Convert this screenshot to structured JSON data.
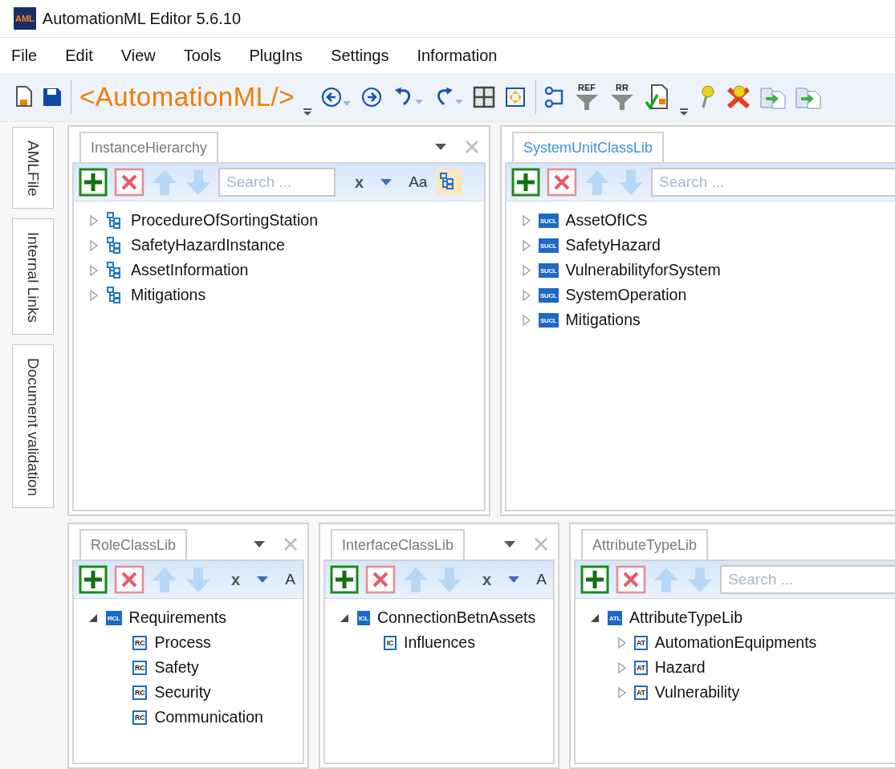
{
  "window": {
    "app_icon_label": "AML",
    "title": "AutomationML Editor 5.6.10"
  },
  "menu": [
    "File",
    "Edit",
    "View",
    "Tools",
    "PlugIns",
    "Settings",
    "Information"
  ],
  "toolbar": [
    {
      "kind": "new-file"
    },
    {
      "kind": "save"
    },
    {
      "kind": "separator"
    },
    {
      "kind": "logo",
      "label": "<AutomationML/>"
    },
    {
      "kind": "overflow"
    },
    {
      "kind": "back",
      "dropdown": true
    },
    {
      "kind": "forward",
      "dropdown": false
    },
    {
      "kind": "undo",
      "dropdown": true
    },
    {
      "kind": "redo",
      "dropdown": true
    },
    {
      "kind": "grid"
    },
    {
      "kind": "fit"
    },
    {
      "kind": "separator"
    },
    {
      "kind": "connector"
    },
    {
      "kind": "filter",
      "label": "REF"
    },
    {
      "kind": "filter",
      "label": "RR"
    },
    {
      "kind": "validate"
    },
    {
      "kind": "overflow"
    },
    {
      "kind": "pin"
    },
    {
      "kind": "unpin"
    },
    {
      "kind": "copy-doc"
    },
    {
      "kind": "copy-doc"
    }
  ],
  "side_tabs": [
    "AMLFile",
    "Internal Links",
    "Document validation"
  ],
  "top_panels": [
    {
      "title": "InstanceHierarchy",
      "tab_selected": false,
      "header_buttons": [
        {
          "kind": "menu"
        },
        {
          "kind": "close"
        }
      ],
      "tools": [
        {
          "kind": "add"
        },
        {
          "kind": "delete"
        },
        {
          "kind": "up"
        },
        {
          "kind": "down"
        },
        {
          "kind": "search",
          "placeholder": "Search ..."
        },
        {
          "kind": "clear",
          "label": "x"
        },
        {
          "kind": "menu"
        },
        {
          "kind": "match-case",
          "label": "Aa"
        },
        {
          "kind": "tree-view",
          "selected": true
        }
      ],
      "tree": [
        {
          "label": "ProcedureOfSortingStation",
          "kind": "hierarchy",
          "expanded": false
        },
        {
          "label": "SafetyHazardInstance",
          "kind": "hierarchy",
          "expanded": false
        },
        {
          "label": "AssetInformation",
          "kind": "hierarchy",
          "expanded": false
        },
        {
          "label": "Mitigations",
          "kind": "hierarchy",
          "expanded": false
        }
      ]
    },
    {
      "title": "SystemUnitClassLib",
      "tab_selected": true,
      "tools": [
        {
          "kind": "add"
        },
        {
          "kind": "delete"
        },
        {
          "kind": "up"
        },
        {
          "kind": "down"
        },
        {
          "kind": "search",
          "placeholder": "Search ..."
        }
      ],
      "tree": [
        {
          "label": "AssetOfICS",
          "kind": "library",
          "badge": "SUCL",
          "expanded": false
        },
        {
          "label": "SafetyHazard",
          "kind": "library",
          "badge": "SUCL",
          "expanded": false
        },
        {
          "label": "VulnerabilityforSystem",
          "kind": "library",
          "badge": "SUCL",
          "expanded": false
        },
        {
          "label": "SystemOperation",
          "kind": "library",
          "badge": "SUCL",
          "expanded": false
        },
        {
          "label": "Mitigations",
          "kind": "library",
          "badge": "SUCL",
          "expanded": false
        }
      ]
    }
  ],
  "bottom_panels": [
    {
      "title": "RoleClassLib",
      "tab_selected": false,
      "header_buttons": [
        {
          "kind": "menu"
        },
        {
          "kind": "close"
        }
      ],
      "tools": [
        {
          "kind": "add"
        },
        {
          "kind": "delete"
        },
        {
          "kind": "up"
        },
        {
          "kind": "down"
        },
        {
          "kind": "clear",
          "label": "x"
        },
        {
          "kind": "menu"
        },
        {
          "kind": "match-case",
          "label": "A"
        }
      ],
      "tree": [
        {
          "label": "Requirements",
          "kind": "library",
          "badge": "RCL",
          "expanded": true,
          "children": [
            {
              "label": "Process",
              "kind": "class",
              "badge": "RC"
            },
            {
              "label": "Safety",
              "kind": "class",
              "badge": "RC"
            },
            {
              "label": "Security",
              "kind": "class",
              "badge": "RC"
            },
            {
              "label": "Communication",
              "kind": "class",
              "badge": "RC"
            }
          ]
        }
      ]
    },
    {
      "title": "InterfaceClassLib",
      "tab_selected": false,
      "header_buttons": [
        {
          "kind": "menu"
        },
        {
          "kind": "close"
        }
      ],
      "tools": [
        {
          "kind": "add"
        },
        {
          "kind": "delete"
        },
        {
          "kind": "up"
        },
        {
          "kind": "down"
        },
        {
          "kind": "clear",
          "label": "x"
        },
        {
          "kind": "menu"
        },
        {
          "kind": "match-case",
          "label": "A"
        }
      ],
      "tree": [
        {
          "label": "ConnectionBetnAssets",
          "kind": "library",
          "badge": "ICL",
          "expanded": true,
          "children": [
            {
              "label": "Influences",
              "kind": "class",
              "badge": "IC"
            }
          ]
        }
      ]
    },
    {
      "title": "AttributeTypeLib",
      "tab_selected": false,
      "tools": [
        {
          "kind": "add"
        },
        {
          "kind": "delete"
        },
        {
          "kind": "up"
        },
        {
          "kind": "down"
        },
        {
          "kind": "search",
          "placeholder": "Search ..."
        }
      ],
      "tree": [
        {
          "label": "AttributeTypeLib",
          "kind": "library",
          "badge": "ATL",
          "expanded": true,
          "children": [
            {
              "label": "AutomationEquipments",
              "kind": "class",
              "badge": "AT",
              "expanded": false
            },
            {
              "label": "Hazard",
              "kind": "class",
              "badge": "AT",
              "expanded": false
            },
            {
              "label": "Vulnerability",
              "kind": "class",
              "badge": "AT",
              "expanded": false
            }
          ]
        }
      ]
    }
  ]
}
